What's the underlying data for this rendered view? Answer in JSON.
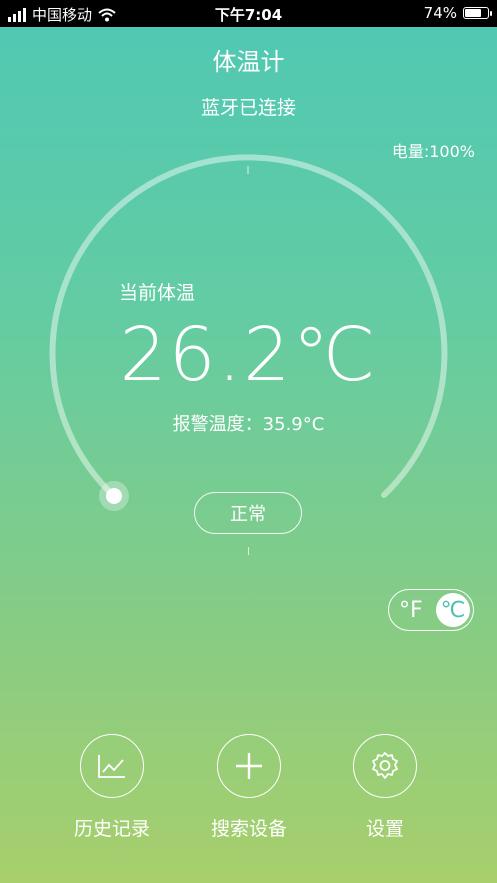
{
  "status_bar": {
    "carrier": "中国移动",
    "time": "下午7:04",
    "battery_percent": "74%",
    "battery_fill_fraction": 0.74,
    "icons": [
      "signal-icon",
      "wifi-icon",
      "battery-icon"
    ]
  },
  "header": {
    "title": "体温计",
    "bluetooth_status": "蓝牙已连接"
  },
  "device": {
    "battery_level": "电量:100%"
  },
  "gauge": {
    "current_label": "当前体温",
    "temperature": "26.2℃",
    "alarm_label": "报警温度：35.9°C",
    "status": "正常"
  },
  "unit_toggle": {
    "fahrenheit": "°F",
    "celsius": "℃",
    "selected": "celsius"
  },
  "bottom_nav": {
    "history": "历史记录",
    "search": "搜索设备",
    "settings": "设置"
  },
  "colors": {
    "gradient_top": "#4fc8b4",
    "gradient_bottom": "#a8cf6c",
    "text": "#ffffff"
  }
}
